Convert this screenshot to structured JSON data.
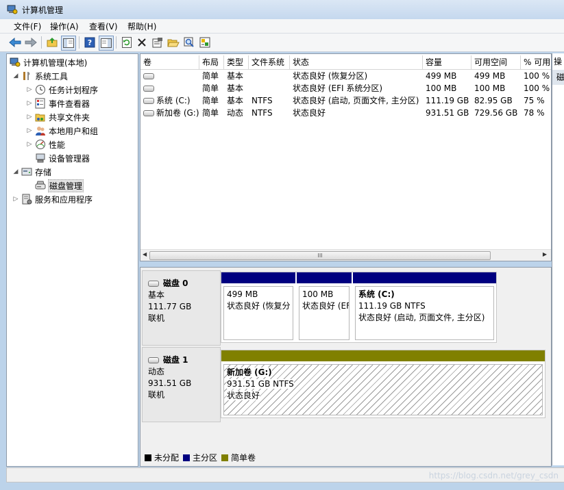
{
  "window": {
    "title": "计算机管理"
  },
  "menu": [
    "文件(F)",
    "操作(A)",
    "查看(V)",
    "帮助(H)"
  ],
  "toolbar": {
    "icons": [
      "back-icon",
      "forward-icon",
      "up-folder-icon",
      "show-hide-tree-icon",
      "help-icon",
      "show-hide-action-pane-icon",
      "refresh-icon",
      "delete-icon",
      "properties-icon",
      "open-icon",
      "search-icon",
      "settings-icon"
    ]
  },
  "tree": [
    {
      "label": "计算机管理(本地)",
      "level": 0,
      "expander": "",
      "icon": "computer-management-icon"
    },
    {
      "label": "系统工具",
      "level": 1,
      "expander": "◢",
      "icon": "system-tools-icon"
    },
    {
      "label": "任务计划程序",
      "level": 2,
      "expander": "▷",
      "icon": "task-scheduler-icon"
    },
    {
      "label": "事件查看器",
      "level": 2,
      "expander": "▷",
      "icon": "event-viewer-icon"
    },
    {
      "label": "共享文件夹",
      "level": 2,
      "expander": "▷",
      "icon": "shared-folders-icon"
    },
    {
      "label": "本地用户和组",
      "level": 2,
      "expander": "▷",
      "icon": "users-groups-icon"
    },
    {
      "label": "性能",
      "level": 2,
      "expander": "▷",
      "icon": "performance-icon"
    },
    {
      "label": "设备管理器",
      "level": 2,
      "expander": "",
      "icon": "device-manager-icon"
    },
    {
      "label": "存储",
      "level": 1,
      "expander": "◢",
      "icon": "storage-icon"
    },
    {
      "label": "磁盘管理",
      "level": 2,
      "expander": "",
      "icon": "disk-management-icon",
      "selected": true
    },
    {
      "label": "服务和应用程序",
      "level": 1,
      "expander": "▷",
      "icon": "services-apps-icon"
    }
  ],
  "volume_list": {
    "columns": [
      "卷",
      "布局",
      "类型",
      "文件系统",
      "状态",
      "容量",
      "可用空间",
      "% 可用"
    ],
    "rows": [
      [
        "",
        "简单",
        "基本",
        "",
        "状态良好 (恢复分区)",
        "499 MB",
        "499 MB",
        "100 %"
      ],
      [
        "",
        "简单",
        "基本",
        "",
        "状态良好 (EFI 系统分区)",
        "100 MB",
        "100 MB",
        "100 %"
      ],
      [
        "系统 (C:)",
        "简单",
        "基本",
        "NTFS",
        "状态良好 (启动, 页面文件, 主分区)",
        "111.19 GB",
        "82.95 GB",
        "75 %"
      ],
      [
        "新加卷 (G:)",
        "简单",
        "动态",
        "NTFS",
        "状态良好",
        "931.51 GB",
        "729.56 GB",
        "78 %"
      ]
    ],
    "scroll_thumb": "III"
  },
  "disks": [
    {
      "name": "磁盘 0",
      "type": "基本",
      "size": "111.77 GB",
      "status": "联机",
      "partitions": [
        {
          "title": "",
          "size_fs": "499 MB",
          "status": "状态良好 (恢复分",
          "color": "#000080"
        },
        {
          "title": "",
          "size_fs": "100 MB",
          "status": "状态良好 (EF",
          "color": "#000080"
        },
        {
          "title": "系统  (C:)",
          "size_fs": "111.19 GB NTFS",
          "status": "状态良好 (启动, 页面文件, 主分区)",
          "color": "#000080"
        }
      ]
    },
    {
      "name": "磁盘 1",
      "type": "动态",
      "size": "931.51 GB",
      "status": "联机",
      "partitions": [
        {
          "title": "新加卷  (G:)",
          "size_fs": "931.51 GB NTFS",
          "status": "状态良好",
          "color": "#808000"
        }
      ]
    }
  ],
  "legend": [
    {
      "label": "未分配",
      "color": "#000000"
    },
    {
      "label": "主分区",
      "color": "#000080"
    },
    {
      "label": "简单卷",
      "color": "#808000"
    }
  ],
  "actions": {
    "header": "操",
    "item": "磁"
  },
  "watermark": "https://blog.csdn.net/grey_csdn"
}
